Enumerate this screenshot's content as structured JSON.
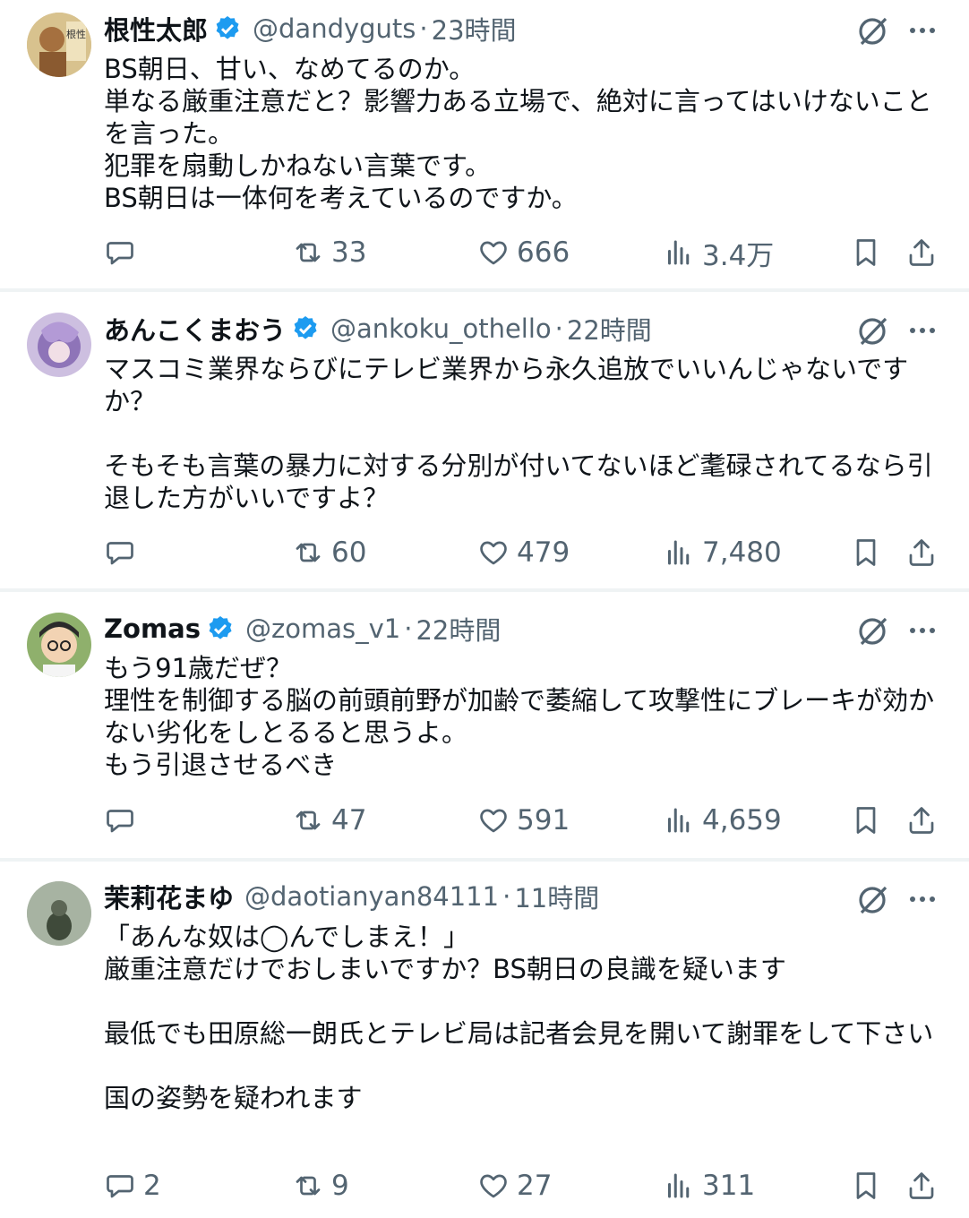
{
  "tweets": [
    {
      "name": "根性太郎",
      "handle": "@dandyguts",
      "time": "23時間",
      "text": "BS朝日、甘い、なめてるのか。\n単なる厳重注意だと？影響力ある立場で、絶対に言ってはいけないことを言った。\n犯罪を扇動しかねない言葉です。\nBS朝日は一体何を考えているのですか。",
      "replies": "",
      "retweets": "33",
      "likes": "666",
      "views": "3.4万",
      "avatar_text": "根性"
    },
    {
      "name": "あんこくまおう",
      "handle": "@ankoku_othello",
      "time": "22時間",
      "text": "マスコミ業界ならびにテレビ業界から永久追放でいいんじゃないですか？\n\nそもそも言葉の暴力に対する分別が付いてないほど耄碌されてるなら引退した方がいいですよ？",
      "replies": "",
      "retweets": "60",
      "likes": "479",
      "views": "7,480"
    },
    {
      "name": "Zomas",
      "handle": "@zomas_v1",
      "time": "22時間",
      "text": "もう91歳だぜ？\n理性を制御する脳の前頭前野が加齢で萎縮して攻撃性にブレーキが効かない劣化をしとるると思うよ。\nもう引退させるべき",
      "replies": "",
      "retweets": "47",
      "likes": "591",
      "views": "4,659"
    },
    {
      "name": "茉莉花まゆ",
      "handle": "@daotianyan84111",
      "time": "11時間",
      "text": "「あんな奴は◯んでしまえ！」\n厳重注意だけでおしまいですか？BS朝日の良識を疑います\n\n最低でも田原総一朗氏とテレビ局は記者会見を開いて謝罪をして下さい\n\n国の姿勢を疑われます",
      "replies": "2",
      "retweets": "9",
      "likes": "27",
      "views": "311"
    }
  ],
  "colors": {
    "text": "#0f1419",
    "secondary": "#536471",
    "verified": "#1d9bf0",
    "divider": "#eff3f4"
  },
  "icons": [
    "verified-badge-icon",
    "grok-icon",
    "more-icon",
    "reply-icon",
    "retweet-icon",
    "like-icon",
    "views-icon",
    "bookmark-icon",
    "share-icon"
  ]
}
